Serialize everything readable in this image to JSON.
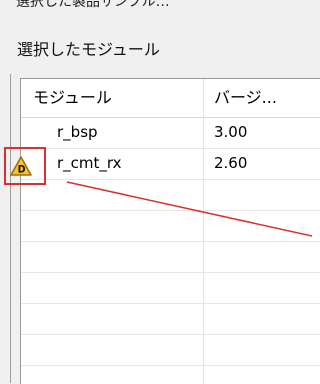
{
  "top_cut_text": "選択した製品サンプル…",
  "section_title": "選択したモジュール",
  "table": {
    "columns": [
      "モジュール",
      "バージ..."
    ],
    "rows": [
      {
        "module": "r_bsp",
        "version": "3.00",
        "icon": null
      },
      {
        "module": "r_cmt_rx",
        "version": "2.60",
        "icon": "deprecated-warning-icon",
        "icon_letter": "D"
      }
    ],
    "empty_rows": 6
  },
  "colors": {
    "highlight_red": "#d93030",
    "warning_yellow": "#f2c23a",
    "warning_border": "#a46a00"
  }
}
